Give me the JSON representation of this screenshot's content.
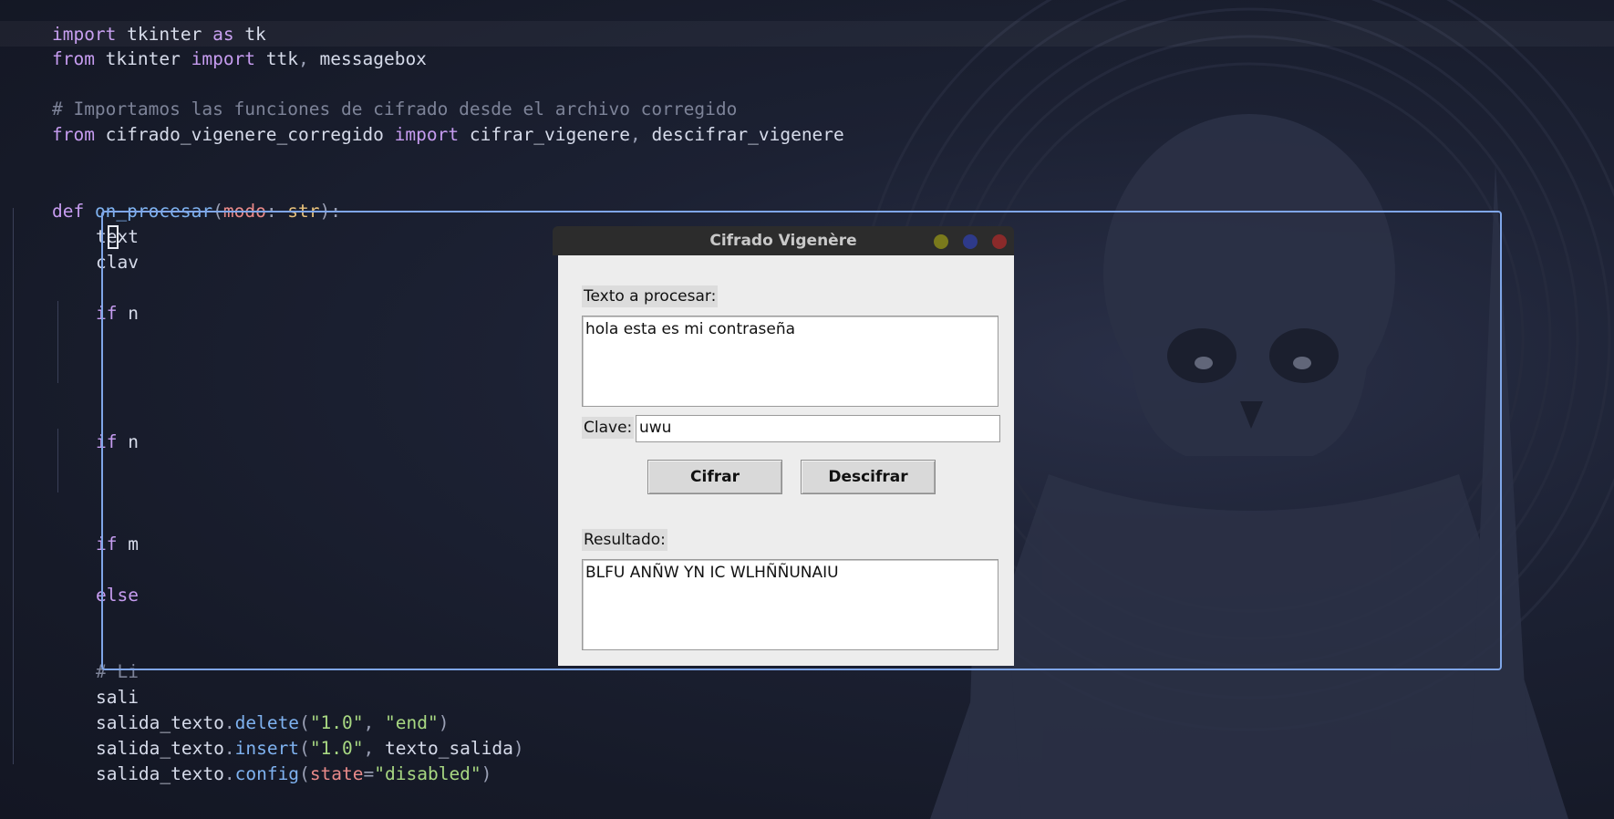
{
  "code": {
    "lines": {
      "l1": {
        "k1": "import",
        "m1": " tkinter ",
        "k2": "as",
        "m2": " tk"
      },
      "l2": {
        "k1": "from",
        "m1": " tkinter ",
        "k2": "import",
        "m2": " ttk",
        "p": ",",
        "m3": " messagebox"
      },
      "l4": {
        "c": "# Importamos las funciones de cifrado desde el archivo corregido"
      },
      "l5": {
        "k1": "from",
        "m1": " cifrado_vigenere_corregido ",
        "k2": "import",
        "m2": " cifrar_vigenere",
        "p": ",",
        "m3": " descifrar_vigenere"
      },
      "l8": {
        "k1": "def",
        "f": " on_procesar",
        "p1": "(",
        "a": "modo",
        "p2": ": ",
        "t": "str",
        "p3": "):"
      },
      "l9": "text",
      "l10": "clav",
      "l12": {
        "k": "if",
        "r": " n"
      },
      "l17": {
        "k": "if",
        "r": " n"
      },
      "l21": {
        "k": "if",
        "r": " m"
      },
      "l23": {
        "k": "else"
      },
      "l26": {
        "c": "# Li"
      },
      "l27": "sali",
      "l28": {
        "o": "salida_texto",
        "d": ".",
        "m": "delete",
        "p1": "(",
        "s1": "\"1.0\"",
        "p2": ", ",
        "s2": "\"end\"",
        "p3": ")"
      },
      "l29": {
        "o": "salida_texto",
        "d": ".",
        "m": "insert",
        "p1": "(",
        "s1": "\"1.0\"",
        "p2": ", ",
        "v": "texto_salida",
        "p3": ")"
      },
      "l30": {
        "o": "salida_texto",
        "d": ".",
        "m": "config",
        "p1": "(",
        "a": "state",
        "eq": "=",
        "s": "\"disabled\"",
        "p3": ")"
      }
    }
  },
  "window": {
    "title": "Cifrado Vigenère",
    "input_label": "Texto a procesar:",
    "input_text": "hola esta es mi contraseña",
    "key_label": "Clave:",
    "key_value": "uwu",
    "encrypt_button": "Cifrar",
    "decrypt_button": "Descifrar",
    "result_label": "Resultado:",
    "result_text": "BLFU ANÑW YN IC WLHÑÑUNAIU"
  },
  "colors": {
    "background": "#161a28",
    "selection_border": "#7fa6e8",
    "keyword": "#c69cf0",
    "function": "#7fb2f0",
    "string": "#a8d882",
    "comment": "#7d8398"
  }
}
